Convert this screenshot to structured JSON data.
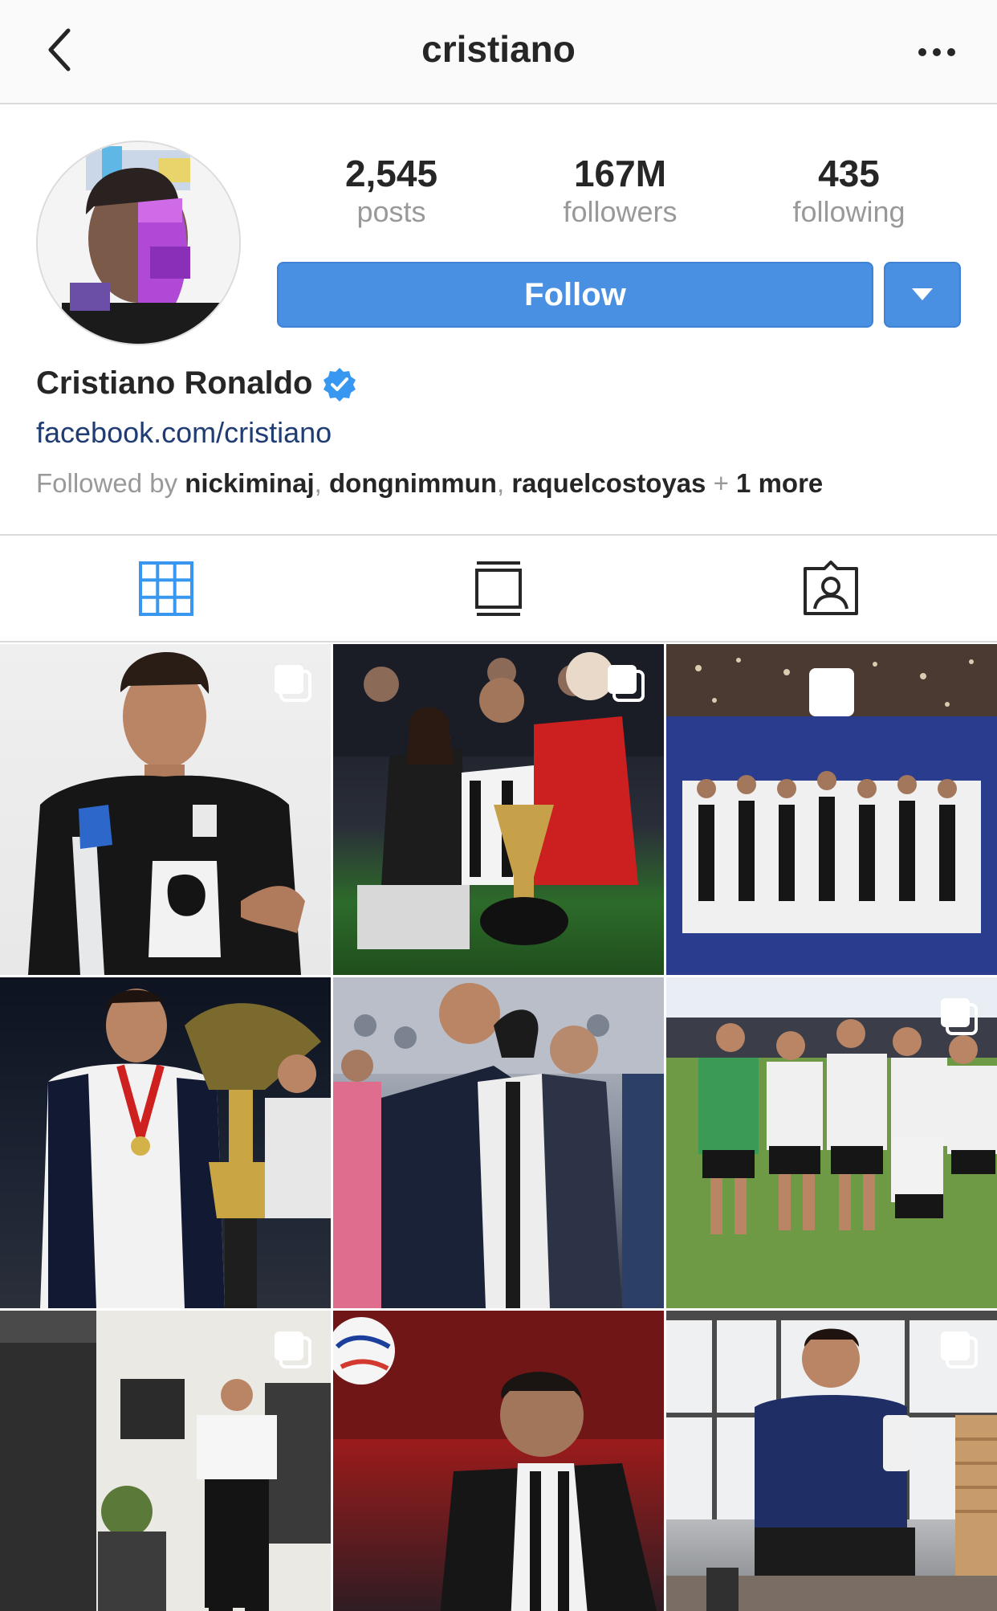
{
  "header": {
    "title": "cristiano",
    "back_icon": "chevron-left-icon",
    "more_icon": "ellipsis-icon"
  },
  "profile": {
    "full_name": "Cristiano Ronaldo",
    "verified": true,
    "link": "facebook.com/cristiano",
    "stats": [
      {
        "value": "2,545",
        "label": "posts"
      },
      {
        "value": "167M",
        "label": "followers"
      },
      {
        "value": "435",
        "label": "following"
      }
    ],
    "follow_label": "Follow",
    "followed_by": {
      "prefix": "Followed by",
      "users": [
        "nickiminaj",
        "dongnimmun",
        "raquelcostoyas"
      ],
      "more": "1 more"
    }
  },
  "tabs": [
    {
      "icon": "grid-icon",
      "active": true
    },
    {
      "icon": "feed-icon",
      "active": false
    },
    {
      "icon": "tagged-icon",
      "active": false
    }
  ],
  "posts": [
    {
      "multi": true
    },
    {
      "multi": true
    },
    {
      "multi": false
    },
    {
      "multi": false
    },
    {
      "multi": false
    },
    {
      "multi": true
    },
    {
      "multi": true
    },
    {
      "multi": false
    },
    {
      "multi": true
    }
  ],
  "colors": {
    "accent": "#4a90e2",
    "link": "#1f3c73",
    "verified": "#3897f0",
    "muted": "#999999",
    "text": "#262626"
  }
}
